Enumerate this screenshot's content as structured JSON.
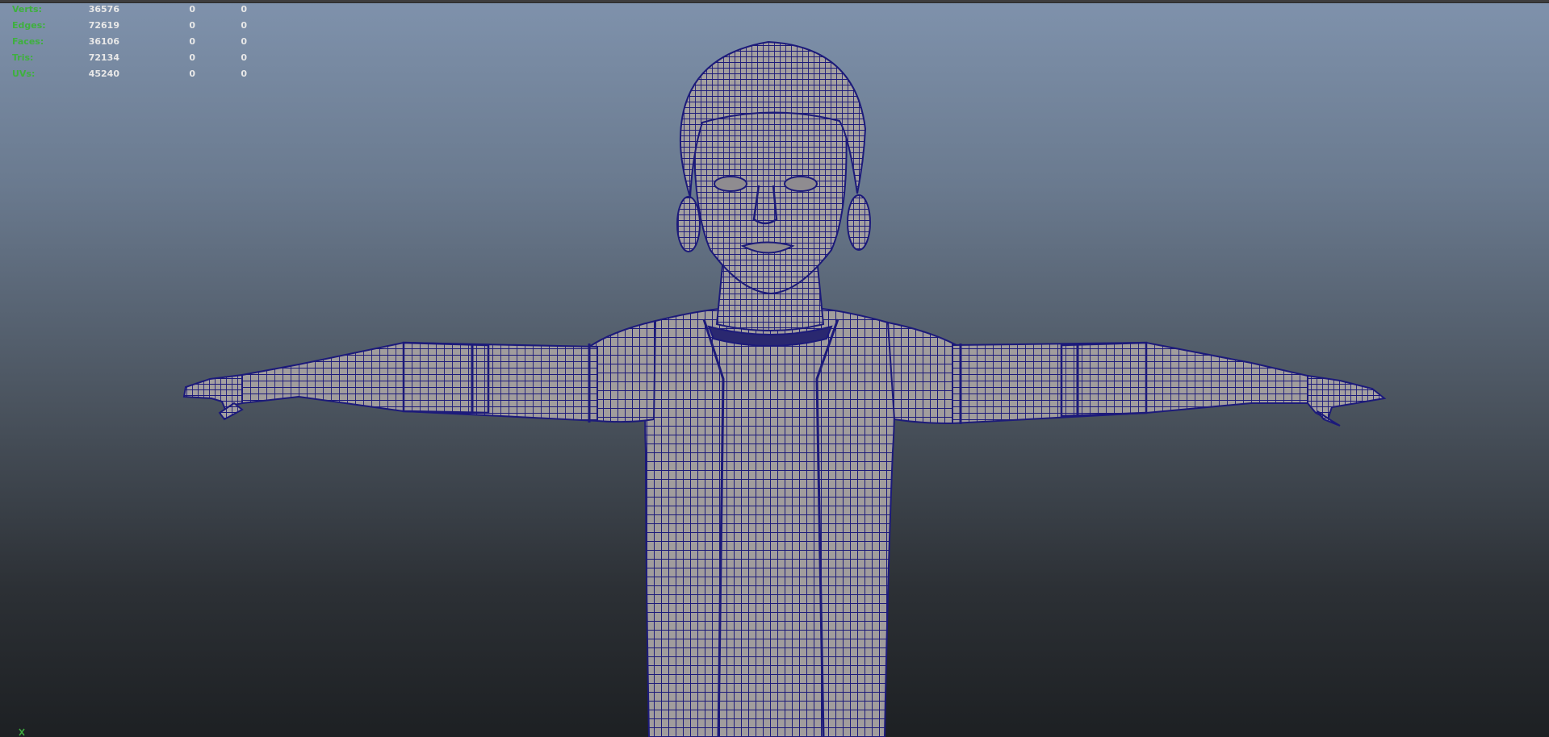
{
  "hud": {
    "rows": [
      {
        "label": "Verts:",
        "total": "36576",
        "selected": "0",
        "component": "0"
      },
      {
        "label": "Edges:",
        "total": "72619",
        "selected": "0",
        "component": "0"
      },
      {
        "label": "Faces:",
        "total": "36106",
        "selected": "0",
        "component": "0"
      },
      {
        "label": "Tris:",
        "total": "72134",
        "selected": "0",
        "component": "0"
      },
      {
        "label": "UVs:",
        "total": "45240",
        "selected": "0",
        "component": "0"
      }
    ]
  },
  "colors": {
    "wire": "#1c1a7a",
    "shade": "#a19d9d",
    "hud_label": "#3fb03f",
    "hud_value": "#e8e8e8"
  },
  "icons": {
    "axis": "axis-gizmo-icon"
  }
}
